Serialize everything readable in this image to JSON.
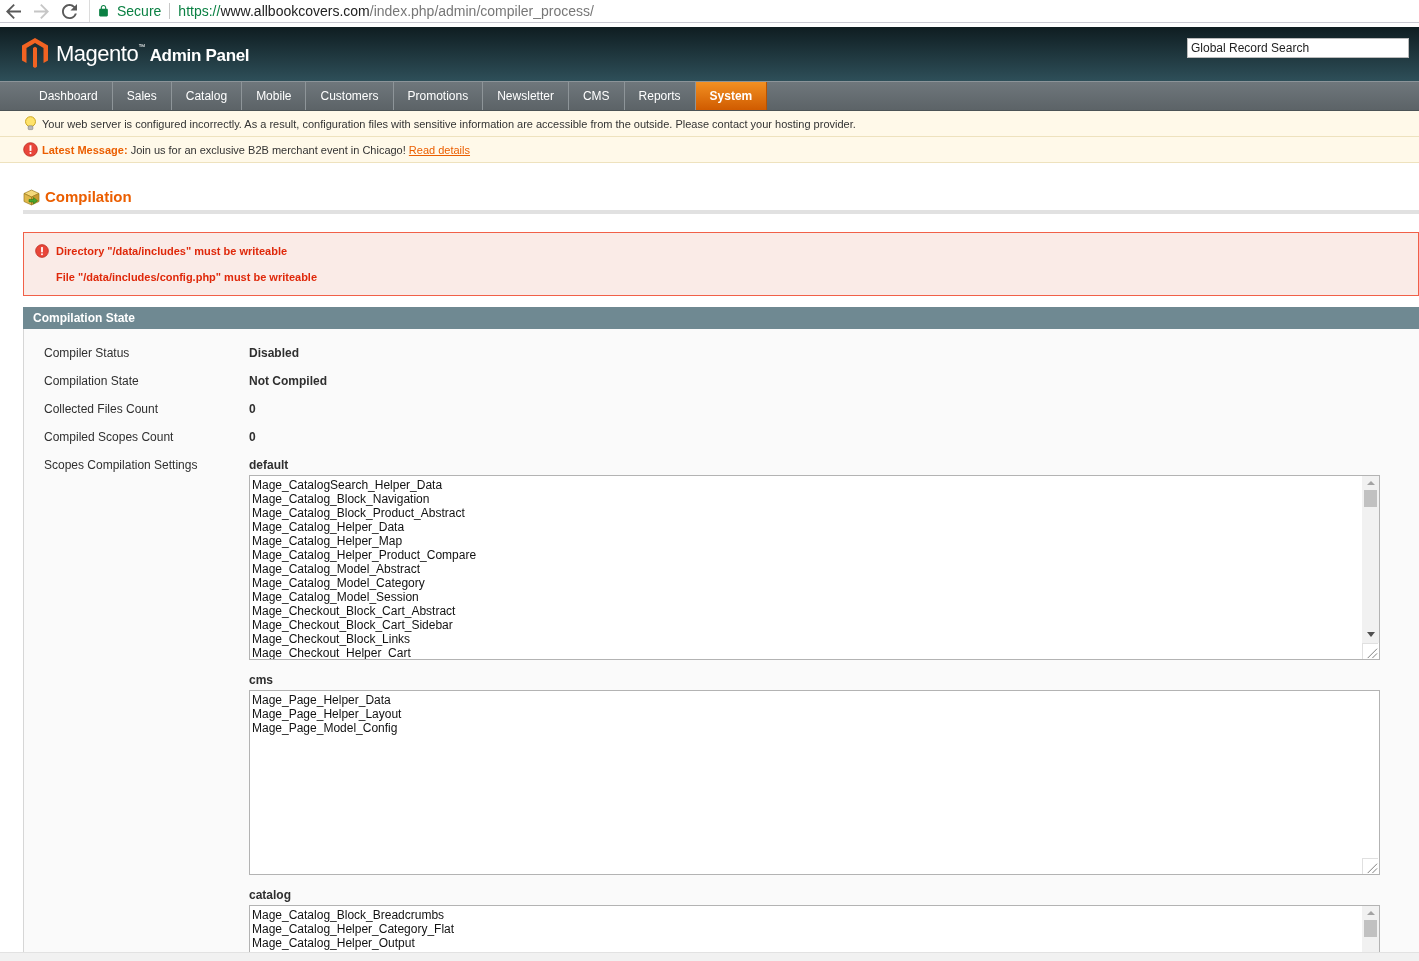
{
  "browser": {
    "forward_disabled": true,
    "secure_label": "Secure",
    "url": {
      "scheme": "https://",
      "host": "www.allbookcovers.com",
      "path": "/index.php/admin/compiler_process/"
    }
  },
  "header": {
    "logo_name": "Magento",
    "logo_mark": "™",
    "logo_suffix": "Admin Panel",
    "search": {
      "value": "Global Record Search"
    }
  },
  "nav": [
    {
      "label": "Dashboard",
      "selected": false
    },
    {
      "label": "Sales",
      "selected": false
    },
    {
      "label": "Catalog",
      "selected": false
    },
    {
      "label": "Mobile",
      "selected": false
    },
    {
      "label": "Customers",
      "selected": false
    },
    {
      "label": "Promotions",
      "selected": false
    },
    {
      "label": "Newsletter",
      "selected": false
    },
    {
      "label": "CMS",
      "selected": false
    },
    {
      "label": "Reports",
      "selected": false
    },
    {
      "label": "System",
      "selected": true
    }
  ],
  "notices": [
    {
      "kind": "warning",
      "text": "Your web server is configured incorrectly. As a result, configuration files with sensitive information are accessible from the outside. Please contact your hosting provider."
    },
    {
      "kind": "message",
      "title": "Latest Message:",
      "text": "Join us for an exclusive B2B merchant event in Chicago!",
      "link": "Read details"
    }
  ],
  "page_title": "Compilation",
  "errors": [
    "Directory \"/data/includes\" must be writeable",
    "File \"/data/includes/config.php\" must be writeable"
  ],
  "section": {
    "title": "Compilation State",
    "fields": [
      {
        "label": "Compiler Status",
        "value": "Disabled"
      },
      {
        "label": "Compilation State",
        "value": "Not Compiled"
      },
      {
        "label": "Collected Files Count",
        "value": "0"
      },
      {
        "label": "Compiled Scopes Count",
        "value": "0"
      }
    ],
    "scopes_label": "Scopes Compilation Settings",
    "scopes": [
      {
        "name": "default",
        "scrollable": true,
        "lines": [
          "Mage_CatalogSearch_Helper_Data",
          "Mage_Catalog_Block_Navigation",
          "Mage_Catalog_Block_Product_Abstract",
          "Mage_Catalog_Helper_Data",
          "Mage_Catalog_Helper_Map",
          "Mage_Catalog_Helper_Product_Compare",
          "Mage_Catalog_Model_Abstract",
          "Mage_Catalog_Model_Category",
          "Mage_Catalog_Model_Session",
          "Mage_Checkout_Block_Cart_Abstract",
          "Mage_Checkout_Block_Cart_Sidebar",
          "Mage_Checkout_Block_Links",
          "Mage_Checkout_Helper_Cart"
        ]
      },
      {
        "name": "cms",
        "scrollable": false,
        "lines": [
          "Mage_Page_Helper_Data",
          "Mage_Page_Helper_Layout",
          "Mage_Page_Model_Config"
        ]
      },
      {
        "name": "catalog",
        "scrollable": true,
        "lines": [
          "Mage_Catalog_Block_Breadcrumbs",
          "Mage_Catalog_Helper_Category_Flat",
          "Mage_Catalog_Helper_Output"
        ]
      }
    ]
  }
}
